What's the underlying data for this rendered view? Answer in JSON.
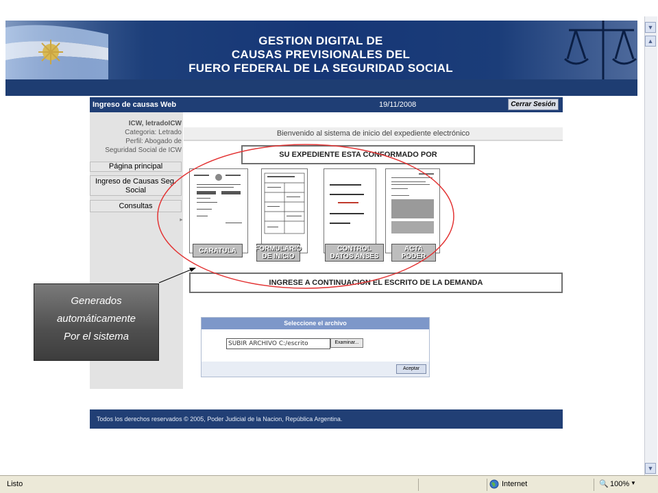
{
  "banner": {
    "line1": "GESTION DIGITAL DE",
    "line2": "CAUSAS PREVISIONALES DEL",
    "line3": "FUERO FEDERAL DE LA SEGURIDAD SOCIAL"
  },
  "app": {
    "title": "Ingreso de causas Web",
    "date": "19/11/2008",
    "logout_label": "Cerrar Sesión"
  },
  "user": {
    "name": "ICW, letradoICW",
    "category": "Categoria: Letrado",
    "profile": "Perfil: Abogado de",
    "profile_cont": "Seguridad Social de ICW"
  },
  "nav": {
    "home": "Página principal",
    "ingreso_line1": "Ingreso de Causas Seg.",
    "ingreso_line2": "Social",
    "consultas": "Consultas"
  },
  "main": {
    "welcome": "Bienvenido al sistema de inicio del expediente electrónico",
    "expediente_header": "SU EXPEDIENTE ESTA CONFORMADO  POR",
    "documents": [
      {
        "line1": "CARATULA",
        "line2": ""
      },
      {
        "line1": "FORMULARIO",
        "line2": "DE INICIO"
      },
      {
        "line1": "CONTROL",
        "line2": "DATOS ANSES"
      },
      {
        "line1": "ACTA",
        "line2": "PODER"
      }
    ],
    "demand_instruction": "INGRESE  A CONTINUACION  EL ESCRITO  DE LA DEMANDA"
  },
  "upload": {
    "header": "Seleccione el archivo",
    "file_value": "SUBIR ARCHIVO C:/escrito",
    "browse_label": "Examinar...",
    "accept_label": "Aceptar"
  },
  "footer": {
    "text": "Todos los derechos reservados © 2005,  Poder Judicial de la Nacion,  República Argentina."
  },
  "callout": {
    "line1": "Generados",
    "line2": "automáticamente",
    "line3": "Por el sistema"
  },
  "statusbar": {
    "status": "Listo",
    "zone": "Internet",
    "zoom": "100%"
  },
  "colors": {
    "banner_blue": "#163676",
    "app_header": "#1f3e75",
    "highlight_ellipse": "#e33434"
  }
}
